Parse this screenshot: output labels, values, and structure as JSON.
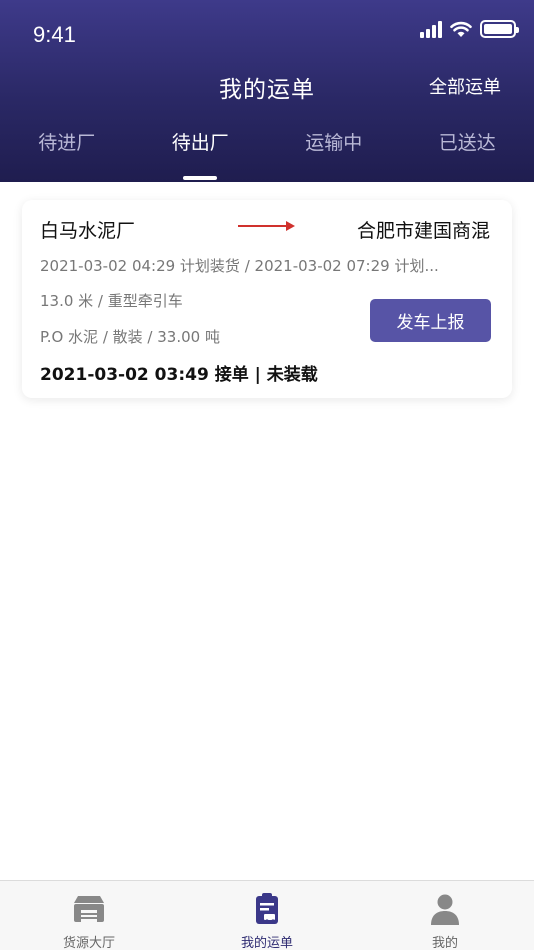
{
  "status_bar": {
    "time": "9:41"
  },
  "header": {
    "title": "我的运单",
    "right_link": "全部运单"
  },
  "tabs": [
    {
      "label": "待进厂",
      "active": false
    },
    {
      "label": "待出厂",
      "active": true
    },
    {
      "label": "运输中",
      "active": false
    },
    {
      "label": "已送达",
      "active": false
    }
  ],
  "orders": [
    {
      "origin": "白马水泥厂",
      "destination": "合肥市建国商混",
      "times": "2021-03-02 04:29 计划装货 / 2021-03-02 07:29 计划...",
      "vehicle": "13.0 米 / 重型牵引车",
      "cargo": "P.O 水泥 / 散装 / 33.00 吨",
      "action_label": "发车上报",
      "summary": "2021-03-02 03:49 接单 | 未装载",
      "arrow_color": "#d0312d"
    }
  ],
  "bottom_nav": [
    {
      "label": "货源大厅",
      "icon": "warehouse-icon",
      "active": false
    },
    {
      "label": "我的运单",
      "icon": "waybill-icon",
      "active": true
    },
    {
      "label": "我的",
      "icon": "user-icon",
      "active": false
    }
  ],
  "colors": {
    "header": "#2a2865",
    "accent": "#5754a6",
    "active_nav": "#2f2c72"
  }
}
